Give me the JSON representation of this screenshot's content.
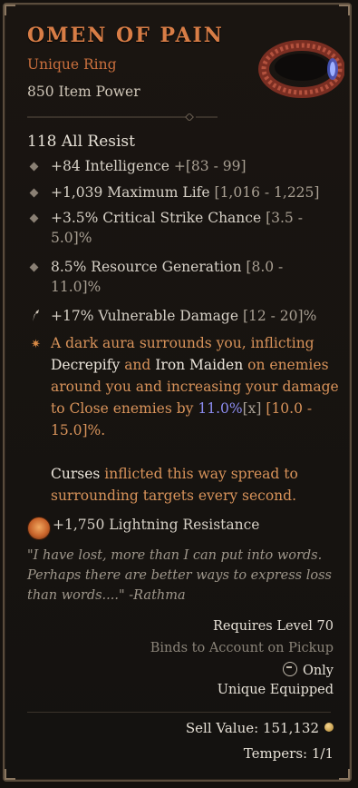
{
  "item": {
    "name": "OMEN OF PAIN",
    "type": "Unique Ring",
    "power": "850 Item Power",
    "implicit": "118 All Resist"
  },
  "affixes": [
    {
      "value": "+84 Intelligence",
      "range": "+[83 - 99]"
    },
    {
      "value": "+1,039 Maximum Life",
      "range": "[1,016 - 1,225]"
    },
    {
      "value": "+3.5% Critical Strike Chance",
      "range": "[3.5 - 5.0]%"
    },
    {
      "value": "8.5% Resource Generation",
      "range": "[8.0 - 11.0]%"
    },
    {
      "value": "+17% Vulnerable Damage",
      "range": "[12 - 20]%"
    }
  ],
  "legendary": {
    "p1": "A dark aura surrounds you, inflicting",
    "decrepify": "Decrepify",
    "and": "and",
    "iron_maiden": "Iron Maiden",
    "on": "on",
    "p2": "enemies around you and increasing your damage to Close enemies by",
    "value": "11.0%",
    "x": "[x]",
    "range": "[10.0 - 15.0]%.",
    "curses": "Curses",
    "p3": "inflicted this way spread to surrounding targets every second."
  },
  "tempered": "+1,750 Lightning Resistance",
  "flavor": "\"I have lost, more than I can put into words. Perhaps there are better ways to express loss than words....\" -Rathma",
  "requirements": {
    "level": "Requires Level 70",
    "binds": "Binds to Account on Pickup",
    "class_only": "Only",
    "unique": "Unique Equipped"
  },
  "sell_value": "Sell Value: 151,132",
  "tempers": "Tempers: 1/1",
  "colors": {
    "title": "#d87d46",
    "blue": "#8c8cf0",
    "orange": "#d8935a"
  },
  "icons": [
    "ring-image",
    "diamond-bullet-icon",
    "vulnerable-icon",
    "legendary-star-icon",
    "lightning-resistance-icon",
    "necromancer-class-icon",
    "gold-coin-icon"
  ]
}
